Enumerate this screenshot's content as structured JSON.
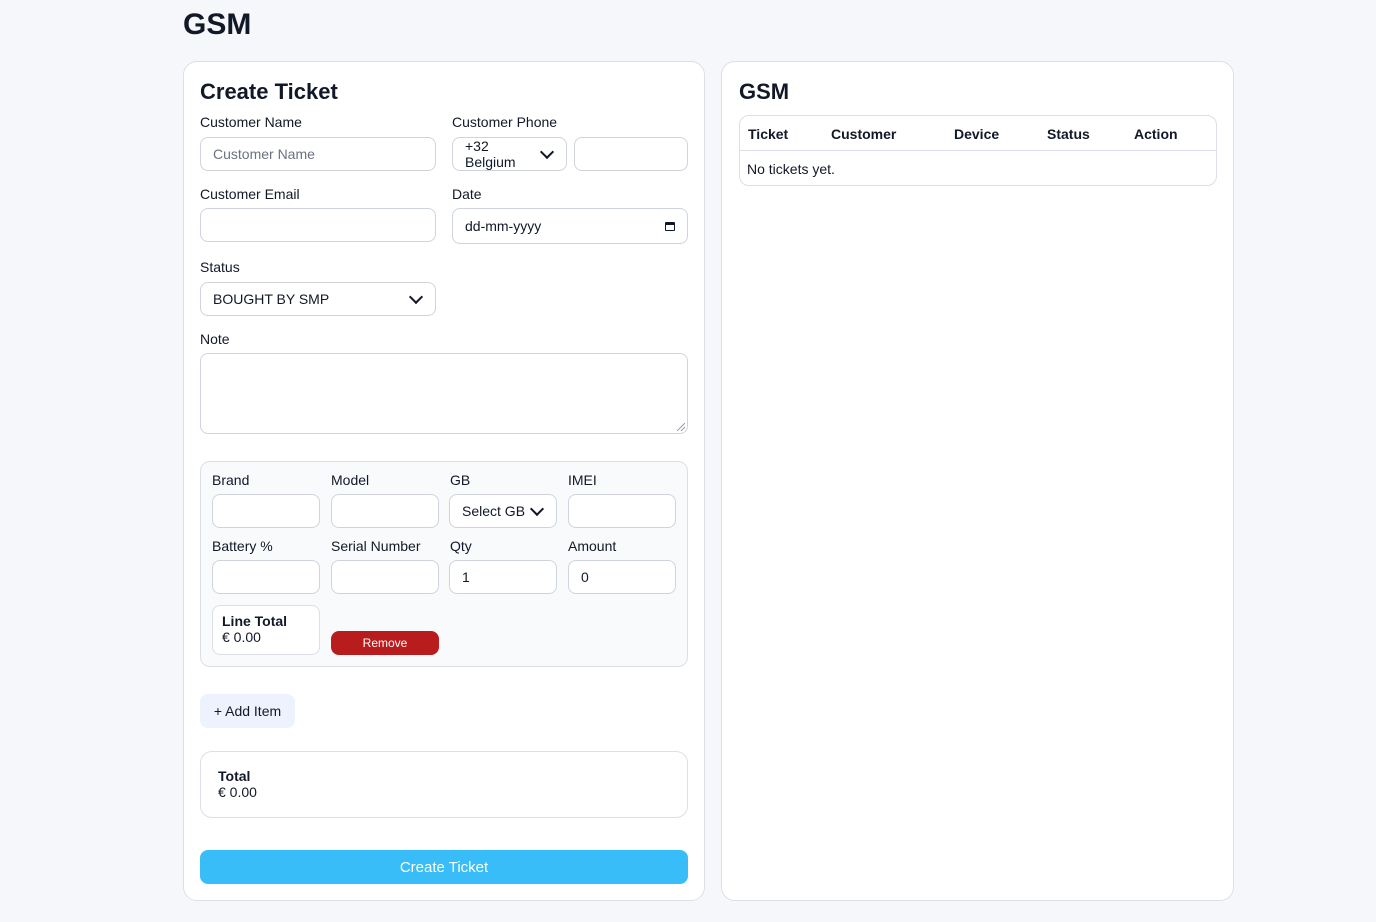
{
  "app": {
    "title": "GSM"
  },
  "create_ticket": {
    "title": "Create Ticket",
    "customer_name": {
      "label": "Customer Name",
      "placeholder": "Customer Name",
      "value": ""
    },
    "customer_phone": {
      "label": "Customer Phone",
      "country_code": "+32 Belgium",
      "value": ""
    },
    "customer_email": {
      "label": "Customer Email",
      "value": ""
    },
    "date": {
      "label": "Date",
      "placeholder": "dd-mm-yyyy"
    },
    "status": {
      "label": "Status",
      "value": "BOUGHT BY SMP"
    },
    "note": {
      "label": "Note",
      "value": ""
    },
    "item": {
      "brand": {
        "label": "Brand",
        "value": ""
      },
      "model": {
        "label": "Model",
        "value": ""
      },
      "gb": {
        "label": "GB",
        "value": "Select GB"
      },
      "imei": {
        "label": "IMEI",
        "value": ""
      },
      "battery": {
        "label": "Battery %",
        "value": ""
      },
      "serial": {
        "label": "Serial Number",
        "value": ""
      },
      "qty": {
        "label": "Qty",
        "value": "1"
      },
      "amount": {
        "label": "Amount",
        "value": "0"
      },
      "line_total": {
        "label": "Line Total",
        "value": "€ 0.00"
      },
      "remove_label": "Remove"
    },
    "add_item_label": "+ Add Item",
    "total": {
      "label": "Total",
      "value": "€ 0.00"
    },
    "submit_label": "Create Ticket"
  },
  "tickets_panel": {
    "title": "GSM",
    "columns": [
      "Ticket",
      "Customer",
      "Device",
      "Status",
      "Action"
    ],
    "empty_message": "No tickets yet."
  },
  "colors": {
    "background": "#f6f7fb",
    "primary_button": "#38bdf8",
    "danger_button": "#b91c1c",
    "add_button_bg": "#eef2ff"
  }
}
